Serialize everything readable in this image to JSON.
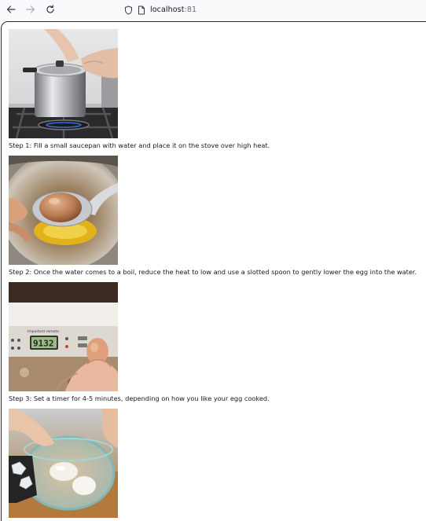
{
  "browser": {
    "url_host": "localhost",
    "url_port": ":81",
    "icons": {
      "back": "arrow-left-icon",
      "forward": "arrow-right-icon",
      "reload": "reload-icon",
      "tracking": "shield-icon",
      "page": "page-icon"
    }
  },
  "steps": [
    {
      "caption": "Step 1: Fill a small saucepan with water and place it on the stove over high heat.",
      "image": "saucepan-on-stove-photo"
    },
    {
      "caption": "Step 2: Once the water comes to a boil, reduce the heat to low and use a slotted spoon to gently lower the egg into the water.",
      "image": "egg-on-spoon-photo"
    },
    {
      "caption": "Step 3: Set a timer for 4-5 minutes, depending on how you like your egg cooked.",
      "image": "kitchen-timer-photo",
      "timer_label": "Important remote",
      "timer_display": "9132"
    },
    {
      "caption": "",
      "image": "eggs-in-ice-bath-photo"
    }
  ],
  "colors": {
    "toolbar_bg": "#f9f9fb",
    "frame": "#2b2a33",
    "text": "#1a1a1a"
  }
}
